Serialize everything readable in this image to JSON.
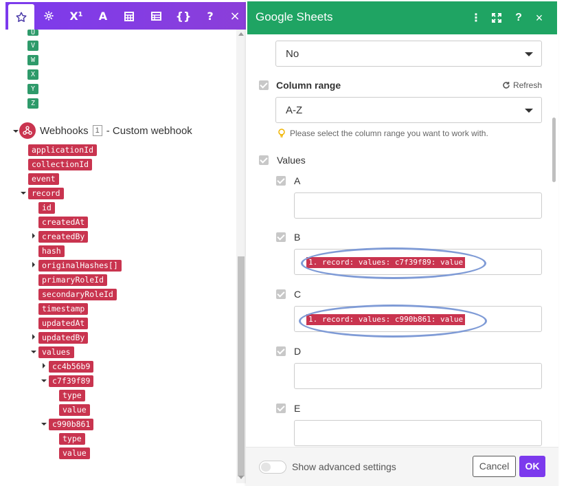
{
  "left": {
    "toolbar_icons": [
      "star-icon",
      "gear-icon",
      "superscript-icon",
      "text-icon",
      "calendar-icon",
      "table-icon",
      "braces-icon",
      "help-icon",
      "close-icon"
    ],
    "toolbar_text": {
      "x1": "X¹",
      "a": "A",
      "braces": "{}",
      "help": "?",
      "close": "×"
    },
    "letters": [
      "U",
      "V",
      "W",
      "X",
      "Y",
      "Z"
    ],
    "webhook": {
      "name": "Webhooks",
      "number": "1",
      "suffix": "- Custom webhook"
    },
    "tree": [
      {
        "label": "applicationId"
      },
      {
        "label": "collectionId"
      },
      {
        "label": "event"
      },
      {
        "label": "record"
      },
      {
        "label": "id"
      },
      {
        "label": "createdAt"
      },
      {
        "label": "createdBy"
      },
      {
        "label": "hash"
      },
      {
        "label": "originalHashes[]"
      },
      {
        "label": "primaryRoleId"
      },
      {
        "label": "secondaryRoleId"
      },
      {
        "label": "timestamp"
      },
      {
        "label": "updatedAt"
      },
      {
        "label": "updatedBy"
      },
      {
        "label": "values"
      },
      {
        "label": "cc4b56b9"
      },
      {
        "label": "c7f39f89"
      },
      {
        "label": "type"
      },
      {
        "label": "value"
      },
      {
        "label": "c990b861"
      },
      {
        "label": "type"
      },
      {
        "label": "value"
      }
    ]
  },
  "right": {
    "title": "Google Sheets",
    "header_icons": [
      "more-vert-icon",
      "expand-icon",
      "help-icon",
      "close-icon"
    ],
    "header_text": {
      "more": "⋮",
      "help": "?",
      "close": "×"
    },
    "top_select_value": "No",
    "column_range": {
      "label": "Column range",
      "refresh": "Refresh",
      "value": "A-Z",
      "hint": "Please select the column range you want to work with."
    },
    "values_label": "Values",
    "columns": [
      {
        "label": "A",
        "value": ""
      },
      {
        "label": "B",
        "value": "1. record: values: c7f39f89: value"
      },
      {
        "label": "C",
        "value": "1. record: values: c990b861: value"
      },
      {
        "label": "D",
        "value": ""
      },
      {
        "label": "E",
        "value": ""
      }
    ],
    "footer": {
      "advanced": "Show advanced settings",
      "cancel": "Cancel",
      "ok": "OK"
    }
  },
  "colors": {
    "purple": "#7c3aed",
    "green": "#1fa463",
    "pill": "#c9344f",
    "letter": "#2e9a6a",
    "oval": "#7f9bd6"
  }
}
